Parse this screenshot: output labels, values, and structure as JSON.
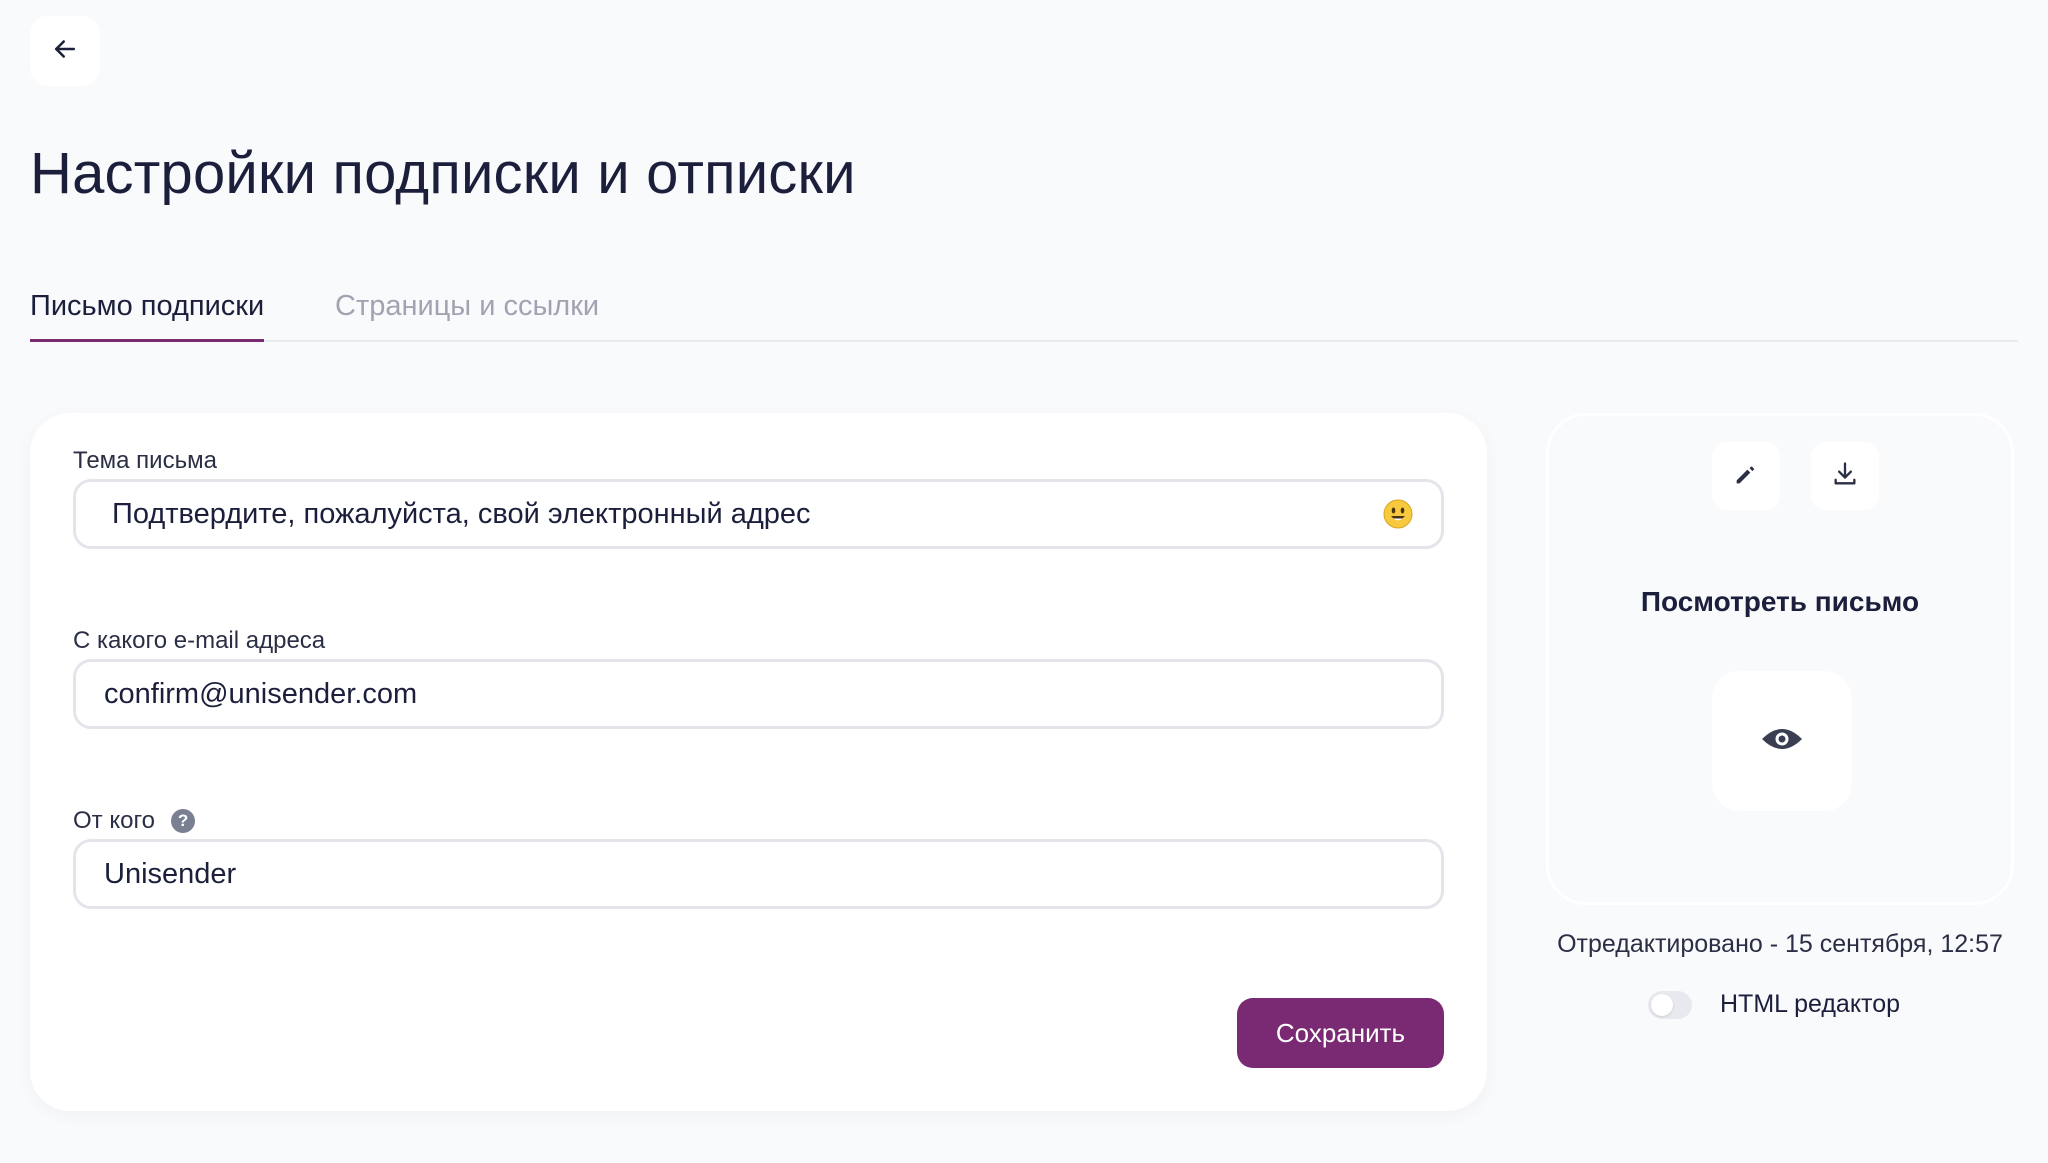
{
  "header": {
    "back_icon": "arrow-left-icon",
    "title": "Настройки подписки и отписки"
  },
  "tabs": [
    {
      "label": "Письмо подписки",
      "active": true
    },
    {
      "label": "Страницы и ссылки",
      "active": false
    }
  ],
  "form": {
    "subject": {
      "label": "Тема письма",
      "value": "Подтвердите, пожалуйста, свой электронный адрес",
      "icon": "emoji-picker-icon"
    },
    "from_email": {
      "label": "С какого e-mail адреса",
      "value": "confirm@unisender.com"
    },
    "from_name": {
      "label": "От кого",
      "help_icon": "?",
      "value": "Unisender"
    },
    "save_label": "Сохранить"
  },
  "preview": {
    "tools": [
      "pencil-icon",
      "download-icon"
    ],
    "title": "Посмотреть письмо",
    "view_icon": "eye-icon",
    "edited": "Отредактировано - 15 сентября, 12:57",
    "html_editor": {
      "label": "HTML редактор",
      "enabled": false
    }
  },
  "colors": {
    "accent": "#7a2a72",
    "background": "#f9fafc",
    "text": "#1b1f3b",
    "muted": "#a0a4b2"
  }
}
